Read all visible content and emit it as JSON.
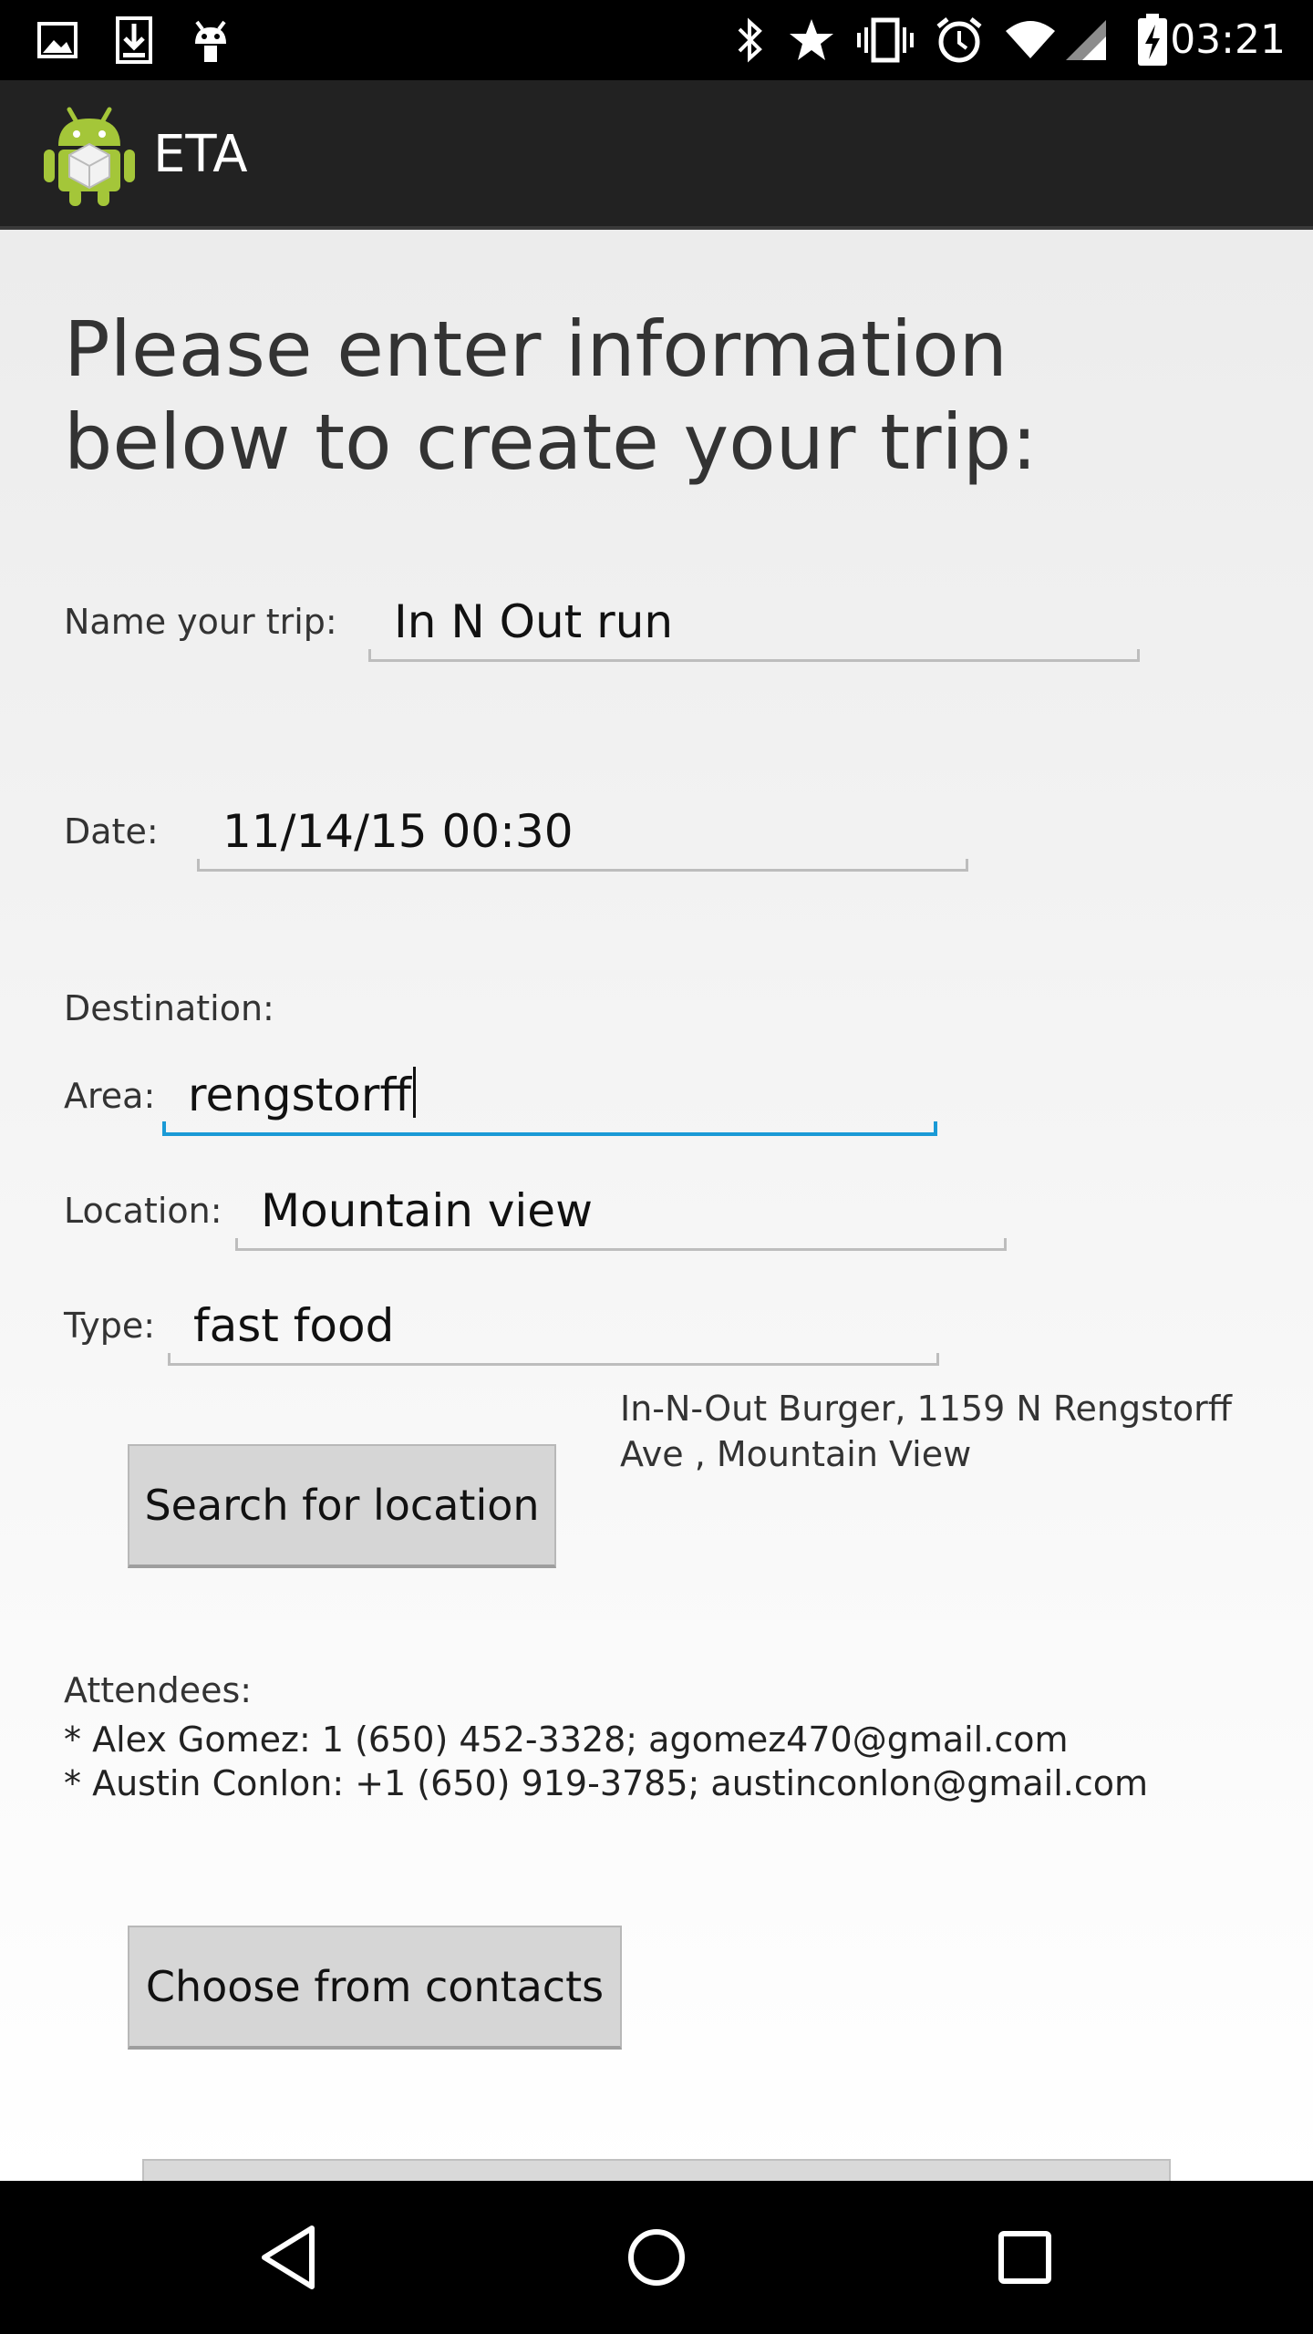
{
  "status_bar": {
    "time": "03:21",
    "left_icons": [
      "image-icon",
      "download-icon",
      "android-icon"
    ],
    "right_icons": [
      "bluetooth-icon",
      "star-icon",
      "vibrate-icon",
      "alarm-icon",
      "wifi-icon",
      "signal-icon",
      "battery-charging-icon"
    ]
  },
  "action_bar": {
    "title": "ETA"
  },
  "form": {
    "headline": "Please enter information below to create your trip:",
    "trip_name_label": "Name your trip:",
    "trip_name_value": "In N Out run",
    "date_label": "Date:",
    "date_value": "11/14/15 00:30",
    "destination_label": "Destination:",
    "area_label": "Area:",
    "area_value": "rengstorff",
    "location_label": "Location:",
    "location_value": "Mountain view",
    "type_label": "Type:",
    "type_value": "fast food",
    "search_button": "Search for location",
    "search_result": "In-N-Out Burger, 1159 N Rengstorff Ave , Mountain View",
    "attendees_label": "Attendees:",
    "attendees": [
      "* Alex Gomez: 1 (650) 452-3328; agomez470@gmail.com",
      "* Austin Conlon: +1 (650) 919-3785; austinconlon@gmail.com"
    ],
    "contacts_button": "Choose from contacts"
  },
  "nav_bar": {
    "icons": [
      "back-icon",
      "home-icon",
      "recents-icon"
    ]
  },
  "colors": {
    "accent": "#1a9ad6",
    "action_bar": "#222222",
    "button": "#d6d6d6"
  }
}
